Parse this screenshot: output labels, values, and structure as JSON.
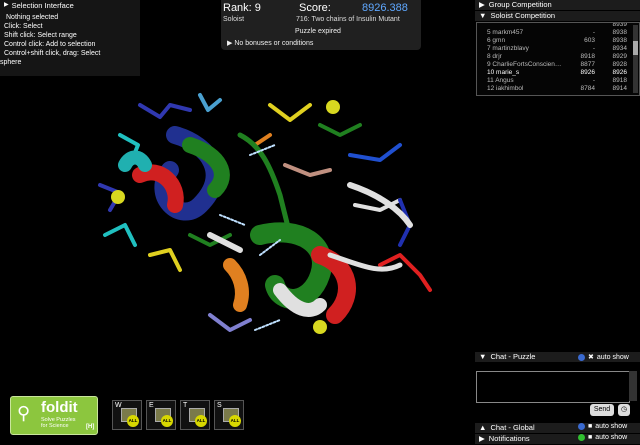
{
  "selection": {
    "title": "Selection Interface",
    "lines": [
      "Nothing selected",
      "Click: Select",
      "Shift click: Select range",
      "Control click: Add to selection",
      "Control+shift click, drag: Select",
      "sphere"
    ]
  },
  "score_panel": {
    "rank": "Rank: 9",
    "score_label": "Score:",
    "score_value": "8926.388",
    "role": "Soloist",
    "puzzle": "716: Two chains of Insulin Mutant",
    "status": "Puzzle expired",
    "bonus": "No bonuses or conditions"
  },
  "right_panel": {
    "group_header": "Group Competition",
    "soloist_header": "Soloist Competition",
    "rows": [
      {
        "name": "",
        "score": "",
        "best": "8939"
      },
      {
        "name": "5 markm457",
        "score": "-",
        "best": "8938"
      },
      {
        "name": "6 gmn",
        "score": "603",
        "best": "8938"
      },
      {
        "name": "7 martinzblavy",
        "score": "-",
        "best": "8934"
      },
      {
        "name": "8 drjr",
        "score": "8918",
        "best": "8929"
      },
      {
        "name": "9 CharlieFortsConscien…",
        "score": "8877",
        "best": "8928"
      },
      {
        "name": "10 marie_s",
        "score": "8926",
        "best": "8926"
      },
      {
        "name": "11 Angus",
        "score": "-",
        "best": "8918"
      },
      {
        "name": "12 iakhimbol",
        "score": "8784",
        "best": "8914"
      }
    ],
    "chat_puzzle": "Chat - Puzzle",
    "chat_global": "Chat - Global",
    "notifications": "Notifications",
    "auto_show": "auto show",
    "send": "Send"
  },
  "logo": {
    "name": "foldit",
    "tagline1": "Solve Puzzles",
    "tagline2": "for Science",
    "help": "[H]"
  },
  "tools": [
    {
      "key": "W",
      "badge": "ALL"
    },
    {
      "key": "E",
      "badge": "ALL"
    },
    {
      "key": "T",
      "badge": "ALL"
    },
    {
      "key": "S",
      "badge": "ALL"
    }
  ],
  "colors": {
    "score": "#5fa8ff",
    "logo": "#8cc63e"
  }
}
